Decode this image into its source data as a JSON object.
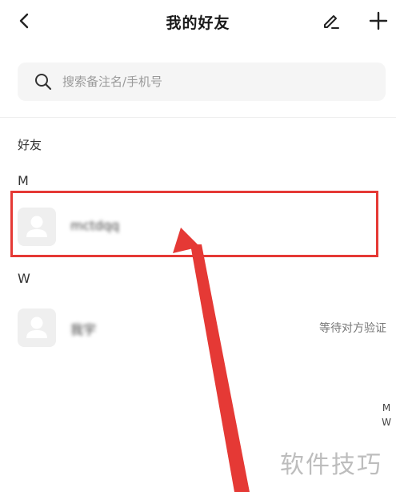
{
  "header": {
    "title": "我的好友"
  },
  "search": {
    "placeholder": "搜索备注名/手机号"
  },
  "section_label": "好友",
  "groups": [
    {
      "letter": "M",
      "contacts": [
        {
          "name": "mctdqq",
          "status": ""
        }
      ]
    },
    {
      "letter": "W",
      "contacts": [
        {
          "name": "我宇",
          "status": "等待对方验证"
        }
      ]
    }
  ],
  "index_bar": [
    "M",
    "W"
  ],
  "watermark": "软件技巧",
  "colors": {
    "highlight": "#e53935",
    "arrow": "#e53935",
    "search_bg": "#f5f5f5",
    "avatar_bg": "#efefef"
  },
  "icons": {
    "back": "chevron-left-icon",
    "edit": "pencil-icon",
    "add": "plus-icon",
    "search": "search-icon",
    "avatar": "person-icon"
  }
}
